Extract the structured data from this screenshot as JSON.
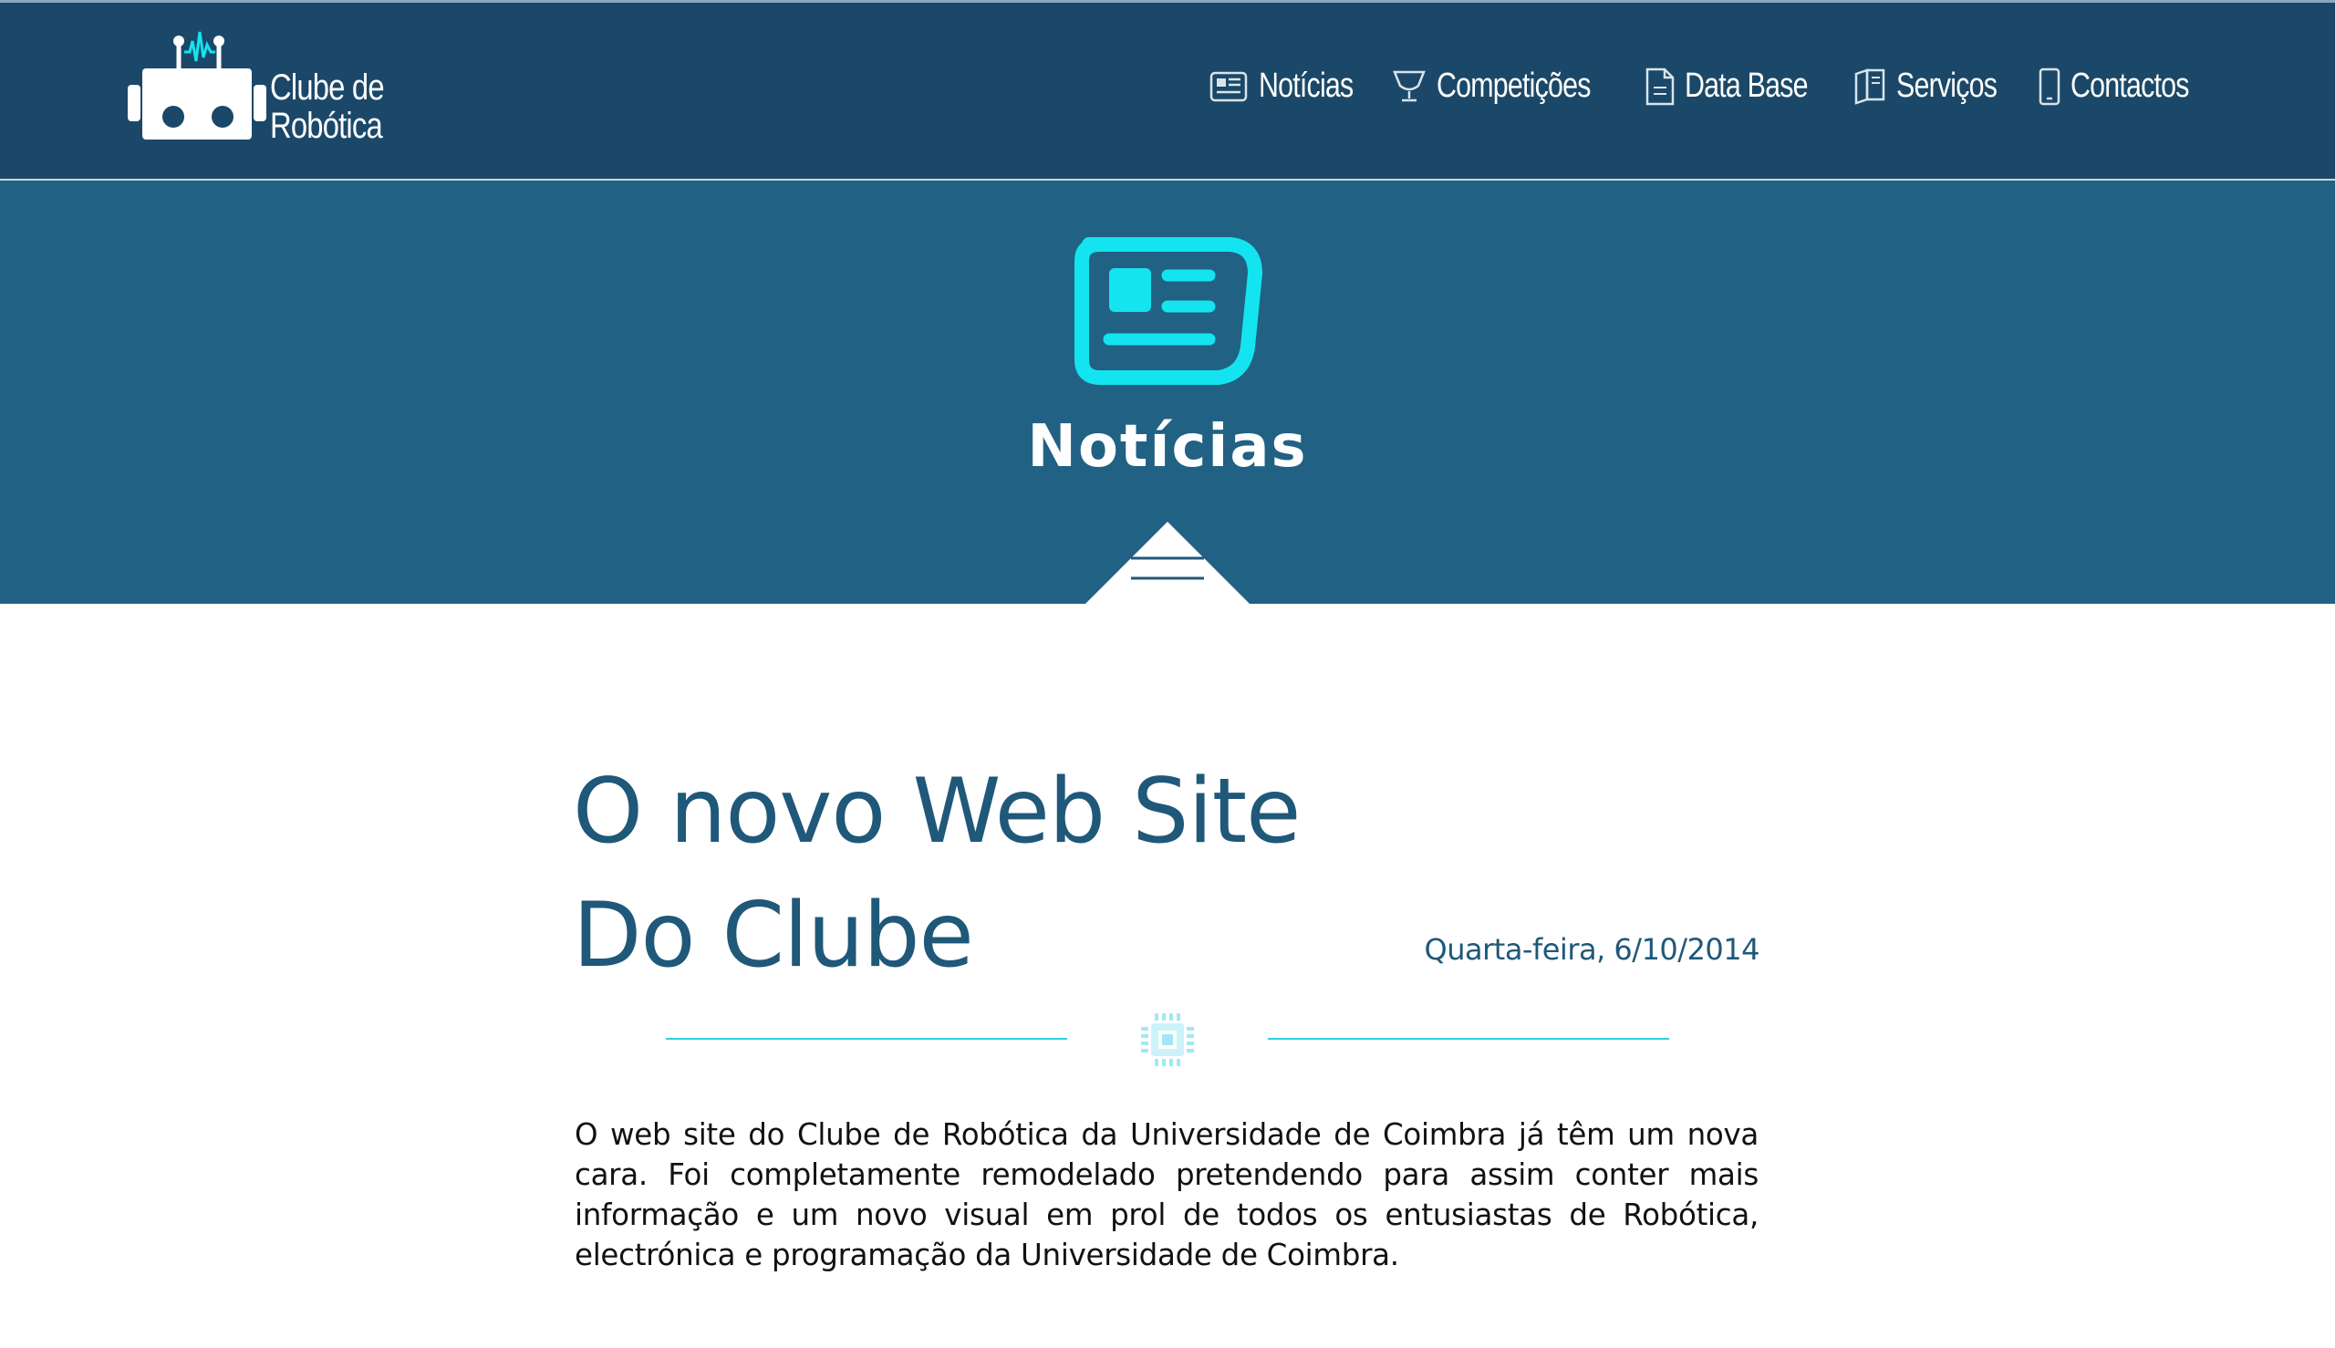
{
  "brand": {
    "line1": "Clube de",
    "line2": "Robótica"
  },
  "nav": {
    "items": [
      {
        "label": "Notícias",
        "icon": "newspaper-icon"
      },
      {
        "label": "Competições",
        "icon": "trophy-icon"
      },
      {
        "label": "Data Base",
        "icon": "document-icon"
      },
      {
        "label": "Serviços",
        "icon": "book-icon"
      },
      {
        "label": "Contactos",
        "icon": "phone-icon"
      }
    ]
  },
  "hero": {
    "title": "Notícias",
    "icon": "newspaper-icon"
  },
  "article": {
    "title_line1": "O novo Web Site",
    "title_line2": "Do Clube",
    "date": "Quarta-feira, 6/10/2014",
    "divider_icon": "chip-icon",
    "body": "O web site do Clube de Robótica da Universidade de Coimbra já têm um nova cara. Foi completamente remodelado pretendendo para assim conter mais informação e um novo visual em prol de todos os entusiastas de Robótica, electrónica e programação da Universidade de Coimbra."
  },
  "colors": {
    "nav_bg": "#1b4868",
    "hero_bg": "#216184",
    "accent_cyan": "#14e4f0",
    "title_blue": "#1f5879"
  }
}
